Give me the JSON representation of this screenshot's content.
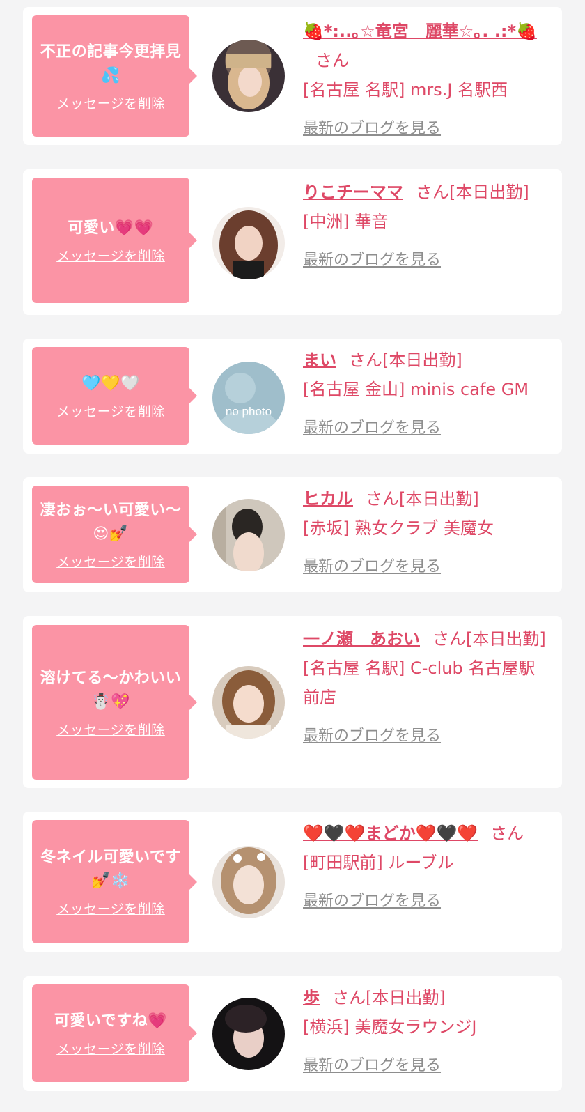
{
  "delete_label": "メッセージを削除",
  "blog_label": "最新のブログを見る",
  "san_label": "さん",
  "colors": {
    "accent": "#de4866",
    "bubble": "#fb94a5",
    "link_gray": "#8e8e8e",
    "background": "#f4f4f5"
  },
  "items": [
    {
      "message": "不正の記事今更拝見💦",
      "name": "🍓*:..｡☆竜宮　麗華☆｡. .:*🍓",
      "status": "",
      "shop": "[名古屋 名駅] mrs.J 名駅西"
    },
    {
      "message": "可愛い💗💗",
      "name": "りこチーママ",
      "status": "[本日出勤]",
      "shop": "[中洲] 華音"
    },
    {
      "message": "🩵💛🤍",
      "name": "まい",
      "status": "[本日出勤]",
      "shop": "[名古屋 金山] minis cafe GM",
      "avatar_text": "no photo"
    },
    {
      "message": "凄おぉ〜い可愛い〜😍💅",
      "name": "ヒカル",
      "status": "[本日出勤]",
      "shop": "[赤坂] 熟女クラブ 美魔女"
    },
    {
      "message": "溶けてる〜かわいい☃️💖",
      "name": "一ノ瀬　あおい",
      "status": "[本日出勤]",
      "shop": "[名古屋 名駅] C-club 名古屋駅前店"
    },
    {
      "message": "冬ネイル可愛いです💅❄️",
      "name": "❤️🖤❤️まどか❤️🖤❤️",
      "status": "",
      "shop": "[町田駅前] ルーブル"
    },
    {
      "message": "可愛いですね💗",
      "name": "歩",
      "status": "[本日出勤]",
      "shop": "[横浜] 美魔女ラウンジJ"
    }
  ]
}
